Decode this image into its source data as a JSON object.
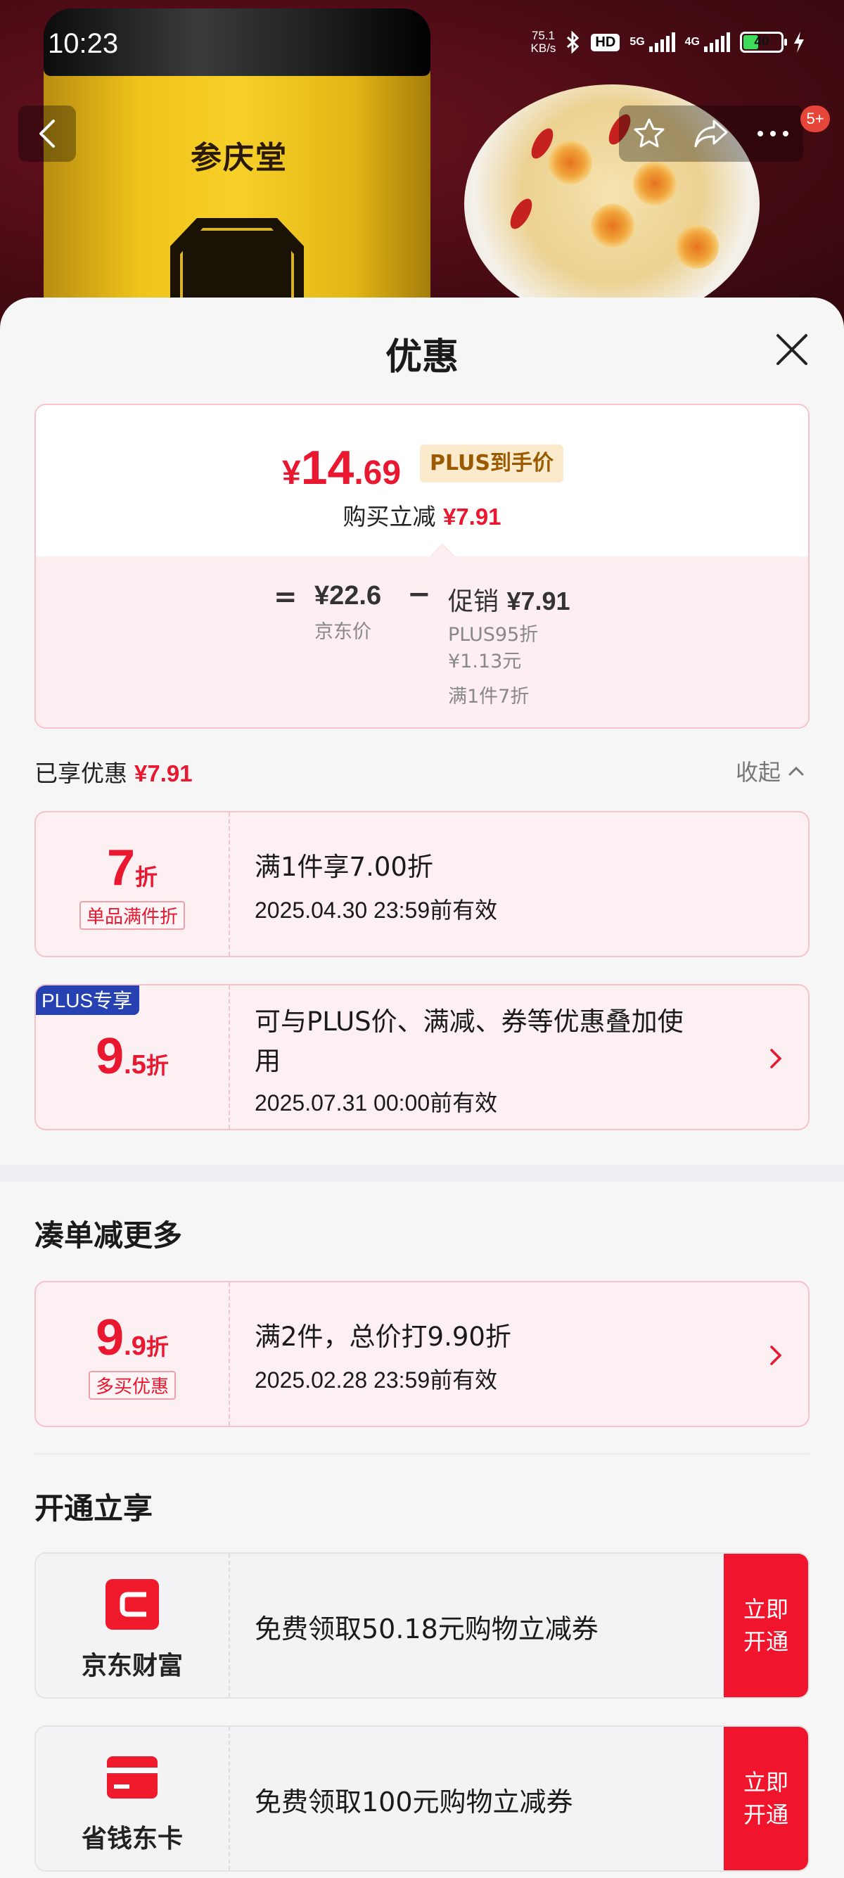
{
  "statusbar": {
    "time": "10:23",
    "net_speed_value": "75.1",
    "net_speed_unit": "KB/s",
    "hd": "HD",
    "sig1": "5G",
    "sig2": "4G",
    "battery": "40",
    "battery_level": 0.4
  },
  "product": {
    "brand": "参庆堂"
  },
  "header": {
    "cart_badge": "5+"
  },
  "sheet": {
    "title": "优惠",
    "price": {
      "currency": "¥",
      "int": "14",
      "dec": ".69",
      "tag": "PLUS到手价",
      "reduce_label": "购买立减",
      "reduce_value": "¥7.91"
    },
    "calc": {
      "eq": "=",
      "base_price": "¥22.6",
      "base_label": "京东价",
      "minus": "−",
      "promo_label": "促销",
      "promo_value": "¥7.91",
      "sub1": "PLUS95折",
      "sub2": "¥1.13元",
      "sub3": "满1件7折"
    },
    "enjoyed": {
      "label": "已享优惠",
      "value": "¥7.91",
      "collapse": "收起"
    },
    "coupons": [
      {
        "disc_big": "7",
        "disc_small": "",
        "zhe": "折",
        "tag": "单品满件折",
        "title": "满1件享7.00折",
        "date": "2025.04.30 23:59前有效"
      },
      {
        "badge": "PLUS专享",
        "disc_big": "9",
        "disc_small": ".5",
        "zhe": "折",
        "title_line1": "可与PLUS价、满减、券等优惠叠加使",
        "title_line2": "用",
        "date": "2025.07.31 00:00前有效"
      }
    ],
    "more": {
      "title": "凑单减更多",
      "coupon": {
        "disc_big": "9",
        "disc_small": ".9",
        "zhe": "折",
        "tag": "多买优惠",
        "title": "满2件，总价打9.90折",
        "date": "2025.02.28 23:59前有效"
      }
    },
    "open": {
      "title": "开通立享",
      "services": [
        {
          "name": "京东财富",
          "text": "免费领取50.18元购物立减券",
          "btn1": "立即",
          "btn2": "开通"
        },
        {
          "name": "省钱东卡",
          "text": "免费领取100元购物立减券",
          "btn1": "立即",
          "btn2": "开通"
        }
      ]
    }
  },
  "colors": {
    "accent_red": "#e9172f",
    "plus_blue": "#2541b2",
    "button_red": "#f0152c"
  }
}
